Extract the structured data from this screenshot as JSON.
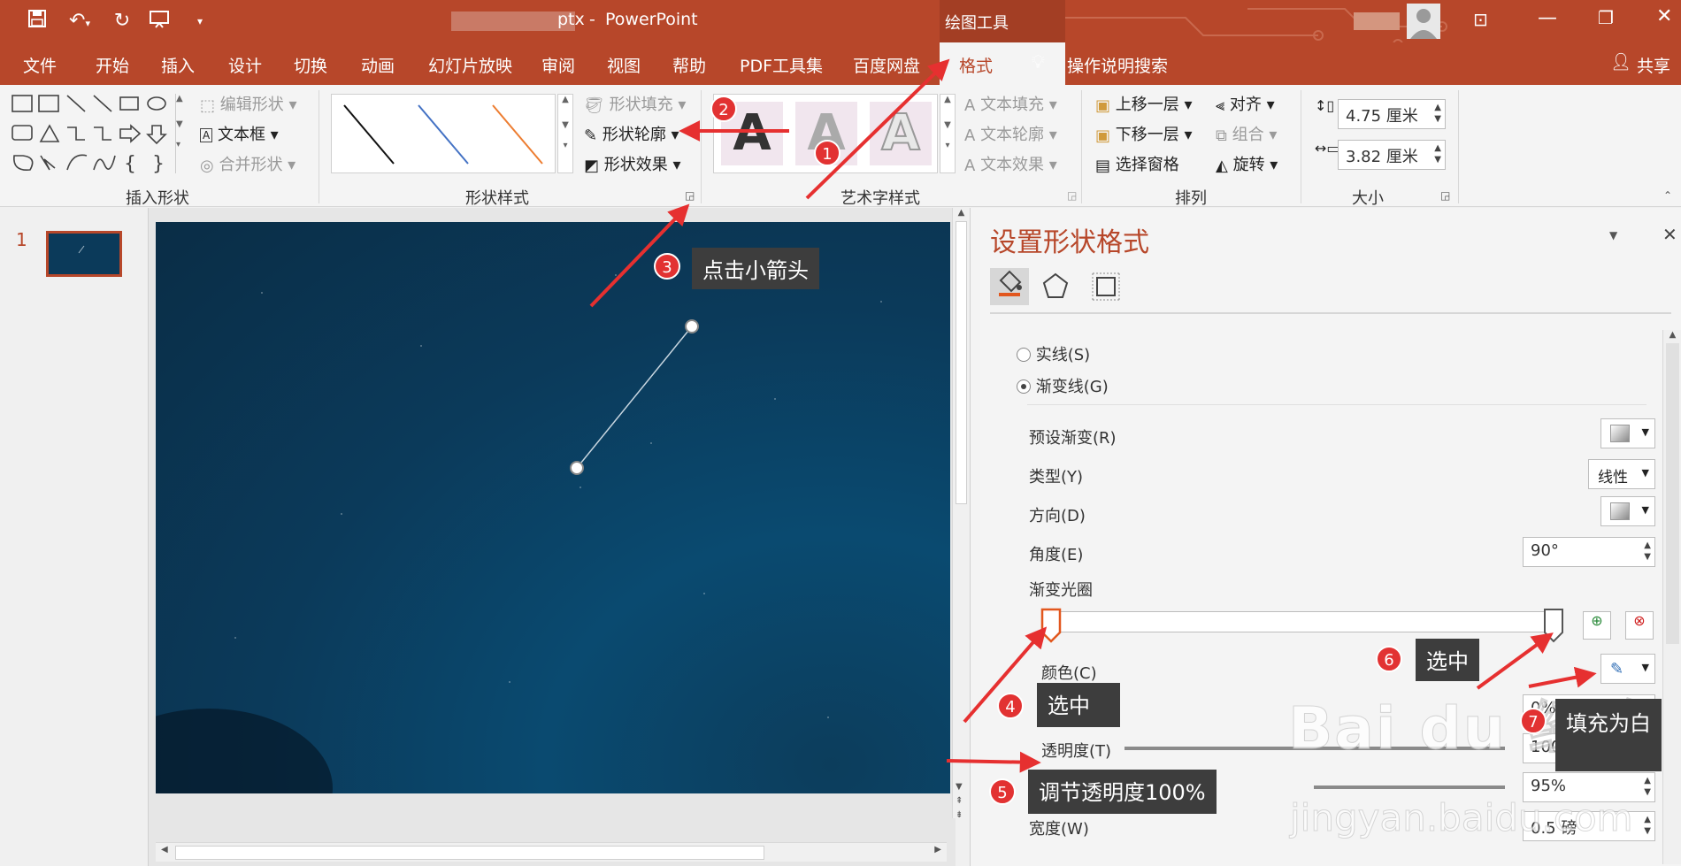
{
  "titlebar": {
    "filename_suffix": "ptx",
    "dash": "-",
    "app": "PowerPoint",
    "context_tool": "绘图工具"
  },
  "tabs": [
    "文件",
    "开始",
    "插入",
    "设计",
    "切换",
    "动画",
    "幻灯片放映",
    "审阅",
    "视图",
    "帮助",
    "PDF工具集",
    "百度网盘",
    "格式"
  ],
  "search_label": "操作说明搜索",
  "share_label": "共享",
  "ribbon": {
    "insert_shapes": {
      "label": "插入形状",
      "edit_shape": "编辑形状",
      "text_box": "文本框",
      "merge_shapes": "合并形状"
    },
    "shape_styles": {
      "label": "形状样式",
      "fill": "形状填充",
      "outline": "形状轮廓",
      "effects": "形状效果"
    },
    "wordart": {
      "label": "艺术字样式",
      "text_fill": "文本填充",
      "text_outline": "文本轮廓",
      "text_effects": "文本效果",
      "letter": "A"
    },
    "arrange": {
      "label": "排列",
      "bring_forward": "上移一层",
      "send_backward": "下移一层",
      "selection_pane": "选择窗格",
      "align": "对齐",
      "group": "组合",
      "rotate": "旋转"
    },
    "size": {
      "label": "大小",
      "height": "4.75 厘米",
      "width": "3.82 厘米"
    }
  },
  "thumbs": {
    "slide_number": "1"
  },
  "pane": {
    "title": "设置形状格式",
    "solid_line": "实线(S)",
    "gradient_line": "渐变线(G)",
    "preset_gradient": "预设渐变(R)",
    "type_label": "类型(Y)",
    "type_value": "线性",
    "direction": "方向(D)",
    "angle_label": "角度(E)",
    "angle_value": "90°",
    "gradient_stops": "渐变光圈",
    "color": "颜色(C)",
    "position_partial": "0)",
    "position_value": "0%",
    "transparency": "透明度(T)",
    "transparency_value": "100%",
    "brightness_value": "95%",
    "width_label": "宽度(W)",
    "width_value": "0.5 磅"
  },
  "annotations": {
    "b1": "1",
    "b2": "2",
    "b3": "3",
    "b4": "4",
    "b5": "5",
    "b6": "6",
    "b7": "7",
    "c3": "点击小箭头",
    "c4": "选中",
    "c5": "调节透明度100%",
    "c6": "选中",
    "c7": "填充为白"
  },
  "watermark": {
    "brand": "Bai du 经验",
    "url": "jingyan.baidu.com"
  },
  "colors": {
    "accent": "#b7472a",
    "annotation_red": "#e23232",
    "callout_bg": "#3d3d3d"
  }
}
